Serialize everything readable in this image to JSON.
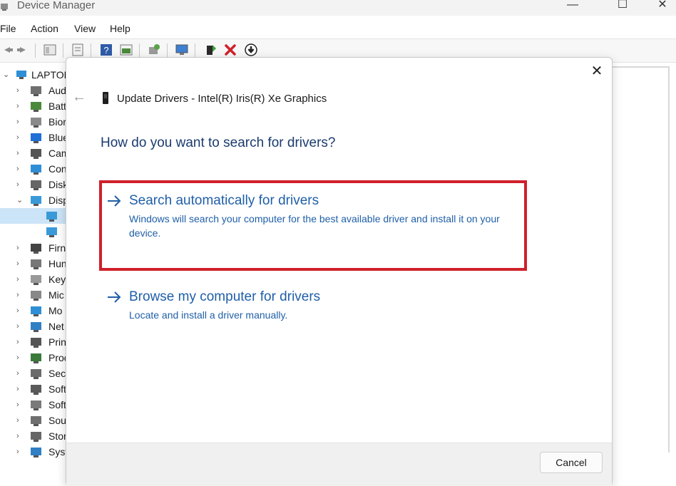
{
  "window": {
    "title": "Device Manager",
    "controls": {
      "minimize": "—",
      "maximize": "☐",
      "close": "✕"
    }
  },
  "menu": [
    {
      "label": "File"
    },
    {
      "label": "Action"
    },
    {
      "label": "View"
    },
    {
      "label": "Help"
    }
  ],
  "toolbar": {
    "buttons": [
      "back-icon",
      "forward-icon",
      "properties-icon",
      "view-icon",
      "help-icon",
      "view-resources-icon",
      "update-driver-icon",
      "scan-hardware-icon",
      "enable-device-icon",
      "uninstall-icon",
      "download-icon"
    ],
    "uninstall_color": "#d0202a"
  },
  "tree": {
    "root": "LAPTOP",
    "items": [
      {
        "label": "Aud",
        "icon": "audio-icon"
      },
      {
        "label": "Batt",
        "icon": "battery-icon"
      },
      {
        "label": "Bior",
        "icon": "biometric-icon"
      },
      {
        "label": "Blue",
        "icon": "bluetooth-icon"
      },
      {
        "label": "Cam",
        "icon": "camera-icon"
      },
      {
        "label": "Con",
        "icon": "computer-icon"
      },
      {
        "label": "Disk",
        "icon": "disk-icon"
      },
      {
        "label": "Disp",
        "icon": "display-icon"
      },
      {
        "label": "",
        "icon": "display-adapter-icon"
      },
      {
        "label": "",
        "icon": "display-adapter-icon"
      },
      {
        "label": "Firn",
        "icon": "firmware-icon"
      },
      {
        "label": "Hun",
        "icon": "hid-icon"
      },
      {
        "label": "Key",
        "icon": "keyboard-icon"
      },
      {
        "label": "Mic",
        "icon": "mouse-icon"
      },
      {
        "label": "Mo",
        "icon": "monitor-icon"
      },
      {
        "label": "Net",
        "icon": "network-icon"
      },
      {
        "label": "Prin",
        "icon": "printer-icon"
      },
      {
        "label": "Proc",
        "icon": "processor-icon"
      },
      {
        "label": "Secu",
        "icon": "security-icon"
      },
      {
        "label": "Soft",
        "icon": "software-component-icon"
      },
      {
        "label": "Soft",
        "icon": "software-device-icon"
      },
      {
        "label": "Sou",
        "icon": "sound-icon"
      },
      {
        "label": "Stor",
        "icon": "storage-icon"
      },
      {
        "label": "Syst",
        "icon": "system-icon"
      }
    ]
  },
  "dialog": {
    "title": "Update Drivers - Intel(R) Iris(R) Xe Graphics",
    "close": "✕",
    "back": "←",
    "heading": "How do you want to search for drivers?",
    "options": [
      {
        "title": "Search automatically for drivers",
        "description": "Windows will search your computer for the best available driver and install it on your device.",
        "highlighted": true
      },
      {
        "title": "Browse my computer for drivers",
        "description": "Locate and install a driver manually.",
        "highlighted": false
      }
    ],
    "cancel": "Cancel",
    "accent_color": "#1f5fa8",
    "highlight_color": "#d0202a"
  }
}
